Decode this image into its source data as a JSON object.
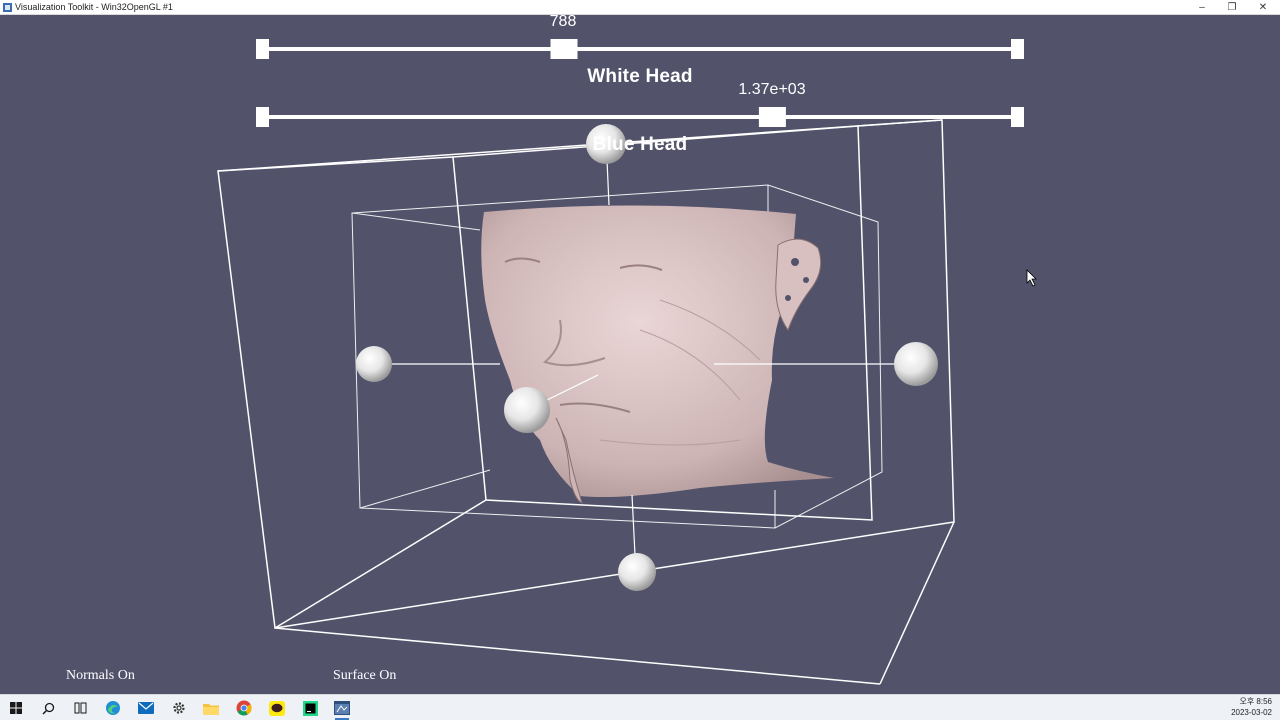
{
  "window": {
    "title": "Visualization Toolkit - Win32OpenGL #1",
    "controls": {
      "minimize": "–",
      "maximize": "❐",
      "close": "✕"
    }
  },
  "sliders": [
    {
      "name": "White Head",
      "value_text": "788",
      "value_fraction": 0.4
    },
    {
      "name": "Blue Head",
      "value_text": "1.37e+03",
      "value_fraction": 0.676
    }
  ],
  "toggles": {
    "normals": "Normals On",
    "surface": "Surface On"
  },
  "colors": {
    "background": "#52526b",
    "widget": "#ffffff",
    "skin": "#dcc5c5"
  },
  "taskbar": {
    "items": [
      {
        "name": "start",
        "icon": "windows-logo-icon"
      },
      {
        "name": "search",
        "icon": "search-icon"
      },
      {
        "name": "task-view",
        "icon": "task-view-icon"
      },
      {
        "name": "edge",
        "icon": "edge-browser-icon"
      },
      {
        "name": "mail",
        "icon": "mail-icon"
      },
      {
        "name": "settings",
        "icon": "gear-icon"
      },
      {
        "name": "file-explorer",
        "icon": "folder-icon"
      },
      {
        "name": "chrome",
        "icon": "chrome-browser-icon"
      },
      {
        "name": "kakaotalk",
        "icon": "chat-app-icon"
      },
      {
        "name": "pycharm",
        "icon": "pycharm-icon"
      },
      {
        "name": "vtk-app",
        "icon": "vtk-window-icon",
        "active": true
      }
    ],
    "clock": {
      "time": "오후 8:56",
      "date": "2023-03-02"
    }
  }
}
